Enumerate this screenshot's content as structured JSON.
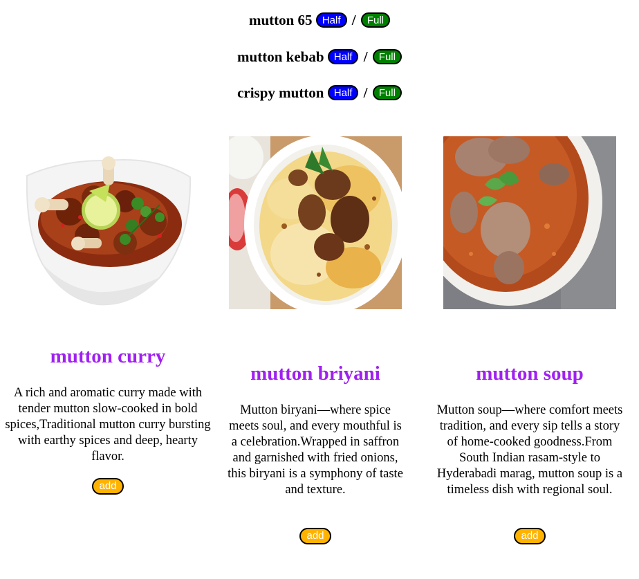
{
  "menu": [
    {
      "name": "mutton 65",
      "half_label": "Half",
      "sep": "/",
      "full_label": "Full"
    },
    {
      "name": "mutton kebab",
      "half_label": "Half",
      "sep": "/",
      "full_label": "Full"
    },
    {
      "name": "crispy mutton",
      "half_label": "Half",
      "sep": "/",
      "full_label": "Full"
    }
  ],
  "cards": [
    {
      "title": "mutton curry",
      "description": "A rich and aromatic curry made with tender mutton slow-cooked in bold spices,Traditional mutton curry bursting with earthy spices and deep, hearty flavor.",
      "add_label": "add"
    },
    {
      "title": "mutton briyani",
      "description": "Mutton biryani—where spice meets soul, and every mouthful is a celebration.Wrapped in saffron and garnished with fried onions, this biryani is a symphony of taste and texture.",
      "add_label": "add"
    },
    {
      "title": "mutton soup",
      "description": "Mutton soup—where comfort meets tradition, and every sip tells a story of home-cooked goodness.From South Indian rasam-style to Hyderabadi marag, mutton soup is a timeless dish with regional soul.",
      "add_label": "add"
    }
  ],
  "colors": {
    "half": "#0000ff",
    "full": "#008000",
    "add": "#ffb300",
    "title": "#a020f0"
  }
}
